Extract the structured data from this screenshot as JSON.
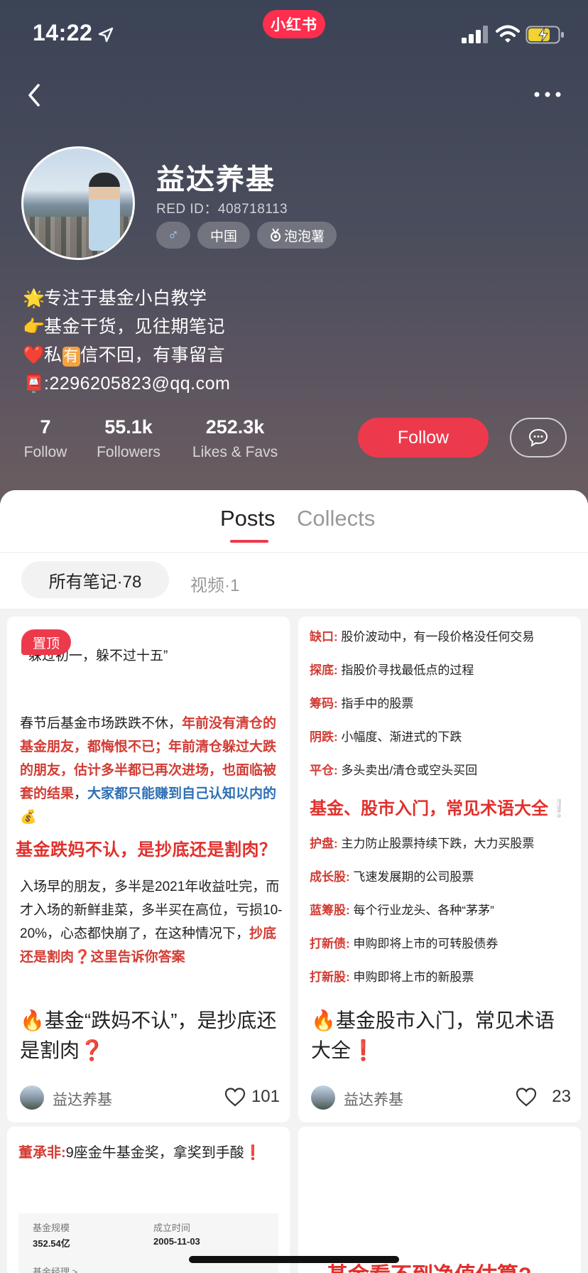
{
  "status_bar": {
    "time": "14:22",
    "app_badge": "小红书"
  },
  "profile": {
    "name": "益达养基",
    "red_id": "RED ID：408718113",
    "tags": {
      "gender": "♂",
      "region": "中国",
      "level": "泡泡薯"
    },
    "bio": [
      {
        "emoji": "🌟",
        "text": "专注于基金小白教学"
      },
      {
        "emoji": "👉",
        "text": "基金干货，见往期笔记"
      },
      {
        "emoji": "❤️",
        "text_before": "私",
        "boxed": "有",
        "text_after": "信不回，有事留言"
      },
      {
        "emoji": "📮",
        "text": ":2296205823@qq.com"
      }
    ],
    "stats": [
      {
        "value": "7",
        "label": "Follow"
      },
      {
        "value": "55.1k",
        "label": "Followers"
      },
      {
        "value": "252.3k",
        "label": "Likes & Favs"
      }
    ],
    "follow_label": "Follow"
  },
  "tabs": [
    {
      "label": "Posts"
    },
    {
      "label": "Collects"
    }
  ],
  "filters": {
    "all": "所有笔记·78",
    "video": "视频·1"
  },
  "cards": [
    {
      "pinned_label": "置顶",
      "quote": "躲过初一，躲不过十五”",
      "p1_plain": "春节后基金市场跌跌不休，",
      "p1_red": "年前没有清仓的基金朋友，都悔恨不已；年前清仓躲过大跌的朋友，估计多半都已再次进场，也面临被套的结果",
      "p1_sep": "，",
      "p1_blue": "大家都只能赚到自己认知以内的",
      "p1_emoji": "💰",
      "heading": "基金跌妈不认，是抄底还是割肉？",
      "p2_plain": "入场早的朋友，多半是2021年收益吐完，而才入场的新鲜韭菜，多半买在高位，亏损10-20%，心态都快崩了，在这种情况下，",
      "p2_red": "抄底还是割肉❓这里告诉你答案",
      "title_emoji": "🔥",
      "title": "基金“跌妈不认”，是抄底还是割肉",
      "title_mark": "❓",
      "author": "益达养基",
      "likes": "101"
    },
    {
      "terms_top": [
        {
          "term": "缺口:",
          "desc": "股价波动中，有一段价格没任何交易"
        },
        {
          "term": "探底:",
          "desc": "指股价寻找最低点的过程"
        },
        {
          "term": "筹码:",
          "desc": "指手中的股票"
        },
        {
          "term": "阴跌:",
          "desc": "小幅度、渐进式的下跌"
        },
        {
          "term": "平仓:",
          "desc": "多头卖出/清仓或空头买回"
        }
      ],
      "heading": "基金、股市入门，常见术语大全",
      "heading_mark": "❕",
      "terms_bottom": [
        {
          "term": "护盘:",
          "desc": "主力防止股票持续下跌，大力买股票"
        },
        {
          "term": "成长股:",
          "desc": "飞速发展期的公司股票"
        },
        {
          "term": "蓝筹股:",
          "desc": "每个行业龙头、各种“茅茅”"
        },
        {
          "term": "打新债:",
          "desc": "申购即将上市的可转股债券"
        },
        {
          "term": "打新股:",
          "desc": "申购即将上市的新股票"
        }
      ],
      "title_emoji": "🔥",
      "title": "基金股市入门，常见术语大全",
      "title_mark": "❗",
      "author": "益达养基",
      "likes": "23"
    },
    {
      "term": "董承非:",
      "text": "9座金牛基金奖，拿奖到手酸",
      "mark": "❗",
      "table": {
        "label1": "基金规模",
        "value1": "352.54亿",
        "label2": "成立时间",
        "value2": "2005-11-03",
        "label3": "基金经理 >"
      }
    },
    {
      "heading": "基金看不到净值估算?"
    }
  ],
  "colors": {
    "brand_red": "#ec3a4c",
    "term_red": "#d23c34",
    "link_blue": "#2d6fb5"
  }
}
